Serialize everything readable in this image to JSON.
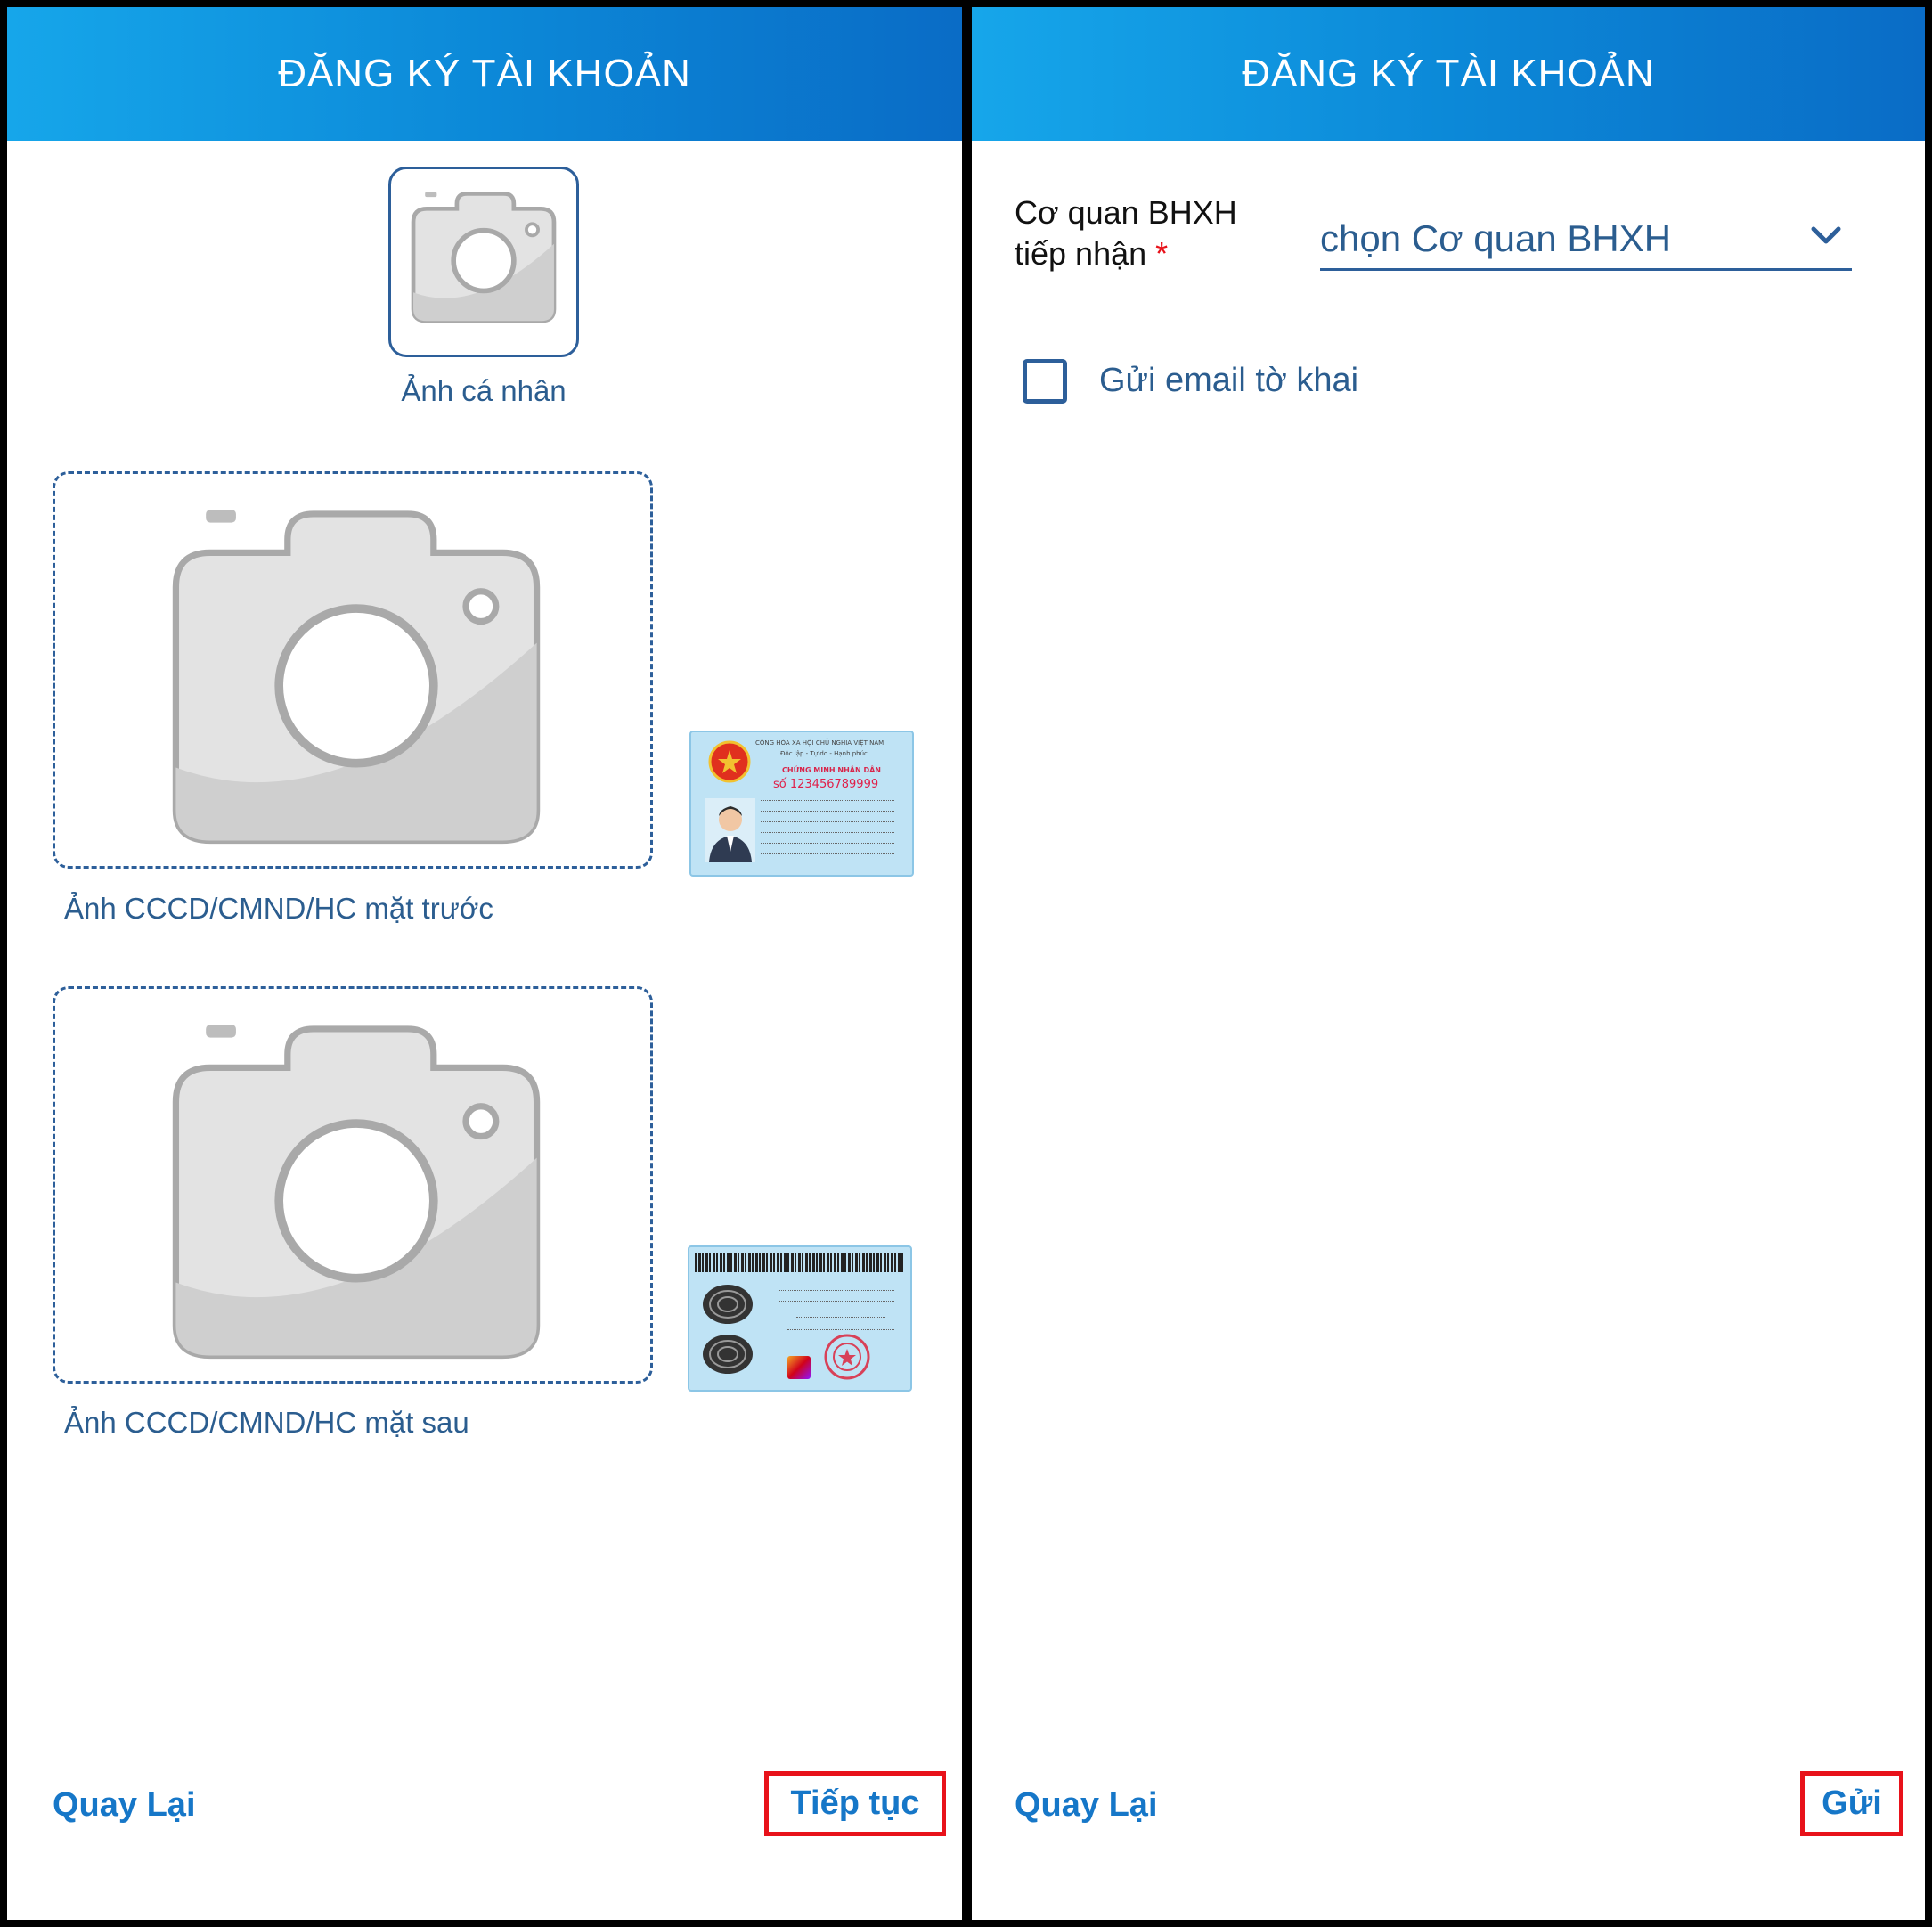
{
  "left_screen": {
    "header_title": "ĐĂNG KÝ TÀI KHOẢN",
    "avatar_label": "Ảnh cá nhân",
    "front_label": "Ảnh CCCD/CMND/HC mặt trước",
    "back_label": "Ảnh CCCD/CMND/HC mặt sau",
    "card_front": {
      "country": "CỘNG HÒA XÃ HỘI CHỦ NGHĨA VIỆT NAM",
      "motto": "Độc lập - Tự do - Hạnh phúc",
      "doc_title": "CHỨNG MINH NHÂN DÂN",
      "number": "số 123456789999"
    },
    "back_button": "Quay Lại",
    "next_button": "Tiếp tục"
  },
  "right_screen": {
    "header_title": "ĐĂNG KÝ TÀI KHOẢN",
    "agency_label_line1": "Cơ quan BHXH",
    "agency_label_line2": "tiếp nhận",
    "required_mark": "*",
    "agency_select_value": "chọn Cơ quan BHXH",
    "email_checkbox_label": "Gửi email tờ khai",
    "email_checked": false,
    "back_button": "Quay Lại",
    "submit_button": "Gửi"
  },
  "colors": {
    "header_gradient_start": "#16a6ea",
    "header_gradient_end": "#0a6cc6",
    "link_blue": "#1677c8",
    "text_blue": "#2b5d8f",
    "highlight_red": "#e8121a"
  },
  "icons": [
    "camera-icon",
    "chevron-down-icon",
    "checkbox-icon"
  ]
}
